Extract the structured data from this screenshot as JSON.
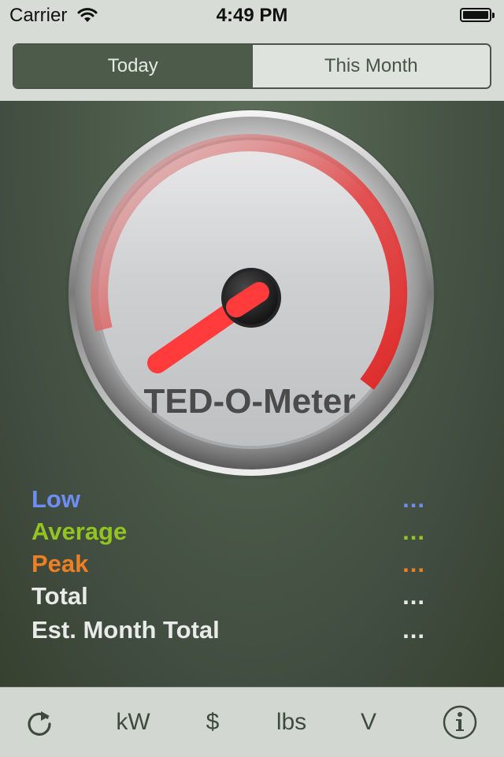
{
  "status_bar": {
    "carrier": "Carrier",
    "time": "4:49 PM",
    "wifi_icon": "wifi-icon",
    "battery_icon": "battery-icon"
  },
  "segments": [
    {
      "label": "Today",
      "selected": true
    },
    {
      "label": "This Month",
      "selected": false
    }
  ],
  "gauge": {
    "title": "TED-O-Meter",
    "needle_color": "#ff3b3b",
    "arc_color": "#e52d2d"
  },
  "stats": {
    "low": {
      "label": "Low",
      "value": "...",
      "color": "#6c8ef2"
    },
    "average": {
      "label": "Average",
      "value": "...",
      "color": "#93c41f"
    },
    "peak": {
      "label": "Peak",
      "value": "...",
      "color": "#ee7f22"
    },
    "total": {
      "label": "Total",
      "value": "..."
    },
    "est_month_total": {
      "label": "Est. Month Total",
      "value": "..."
    }
  },
  "toolbar": {
    "refresh_icon": "refresh-icon",
    "kw": "kW",
    "dollar": "$",
    "lbs": "lbs",
    "volts": "V",
    "info_icon": "info-icon"
  }
}
